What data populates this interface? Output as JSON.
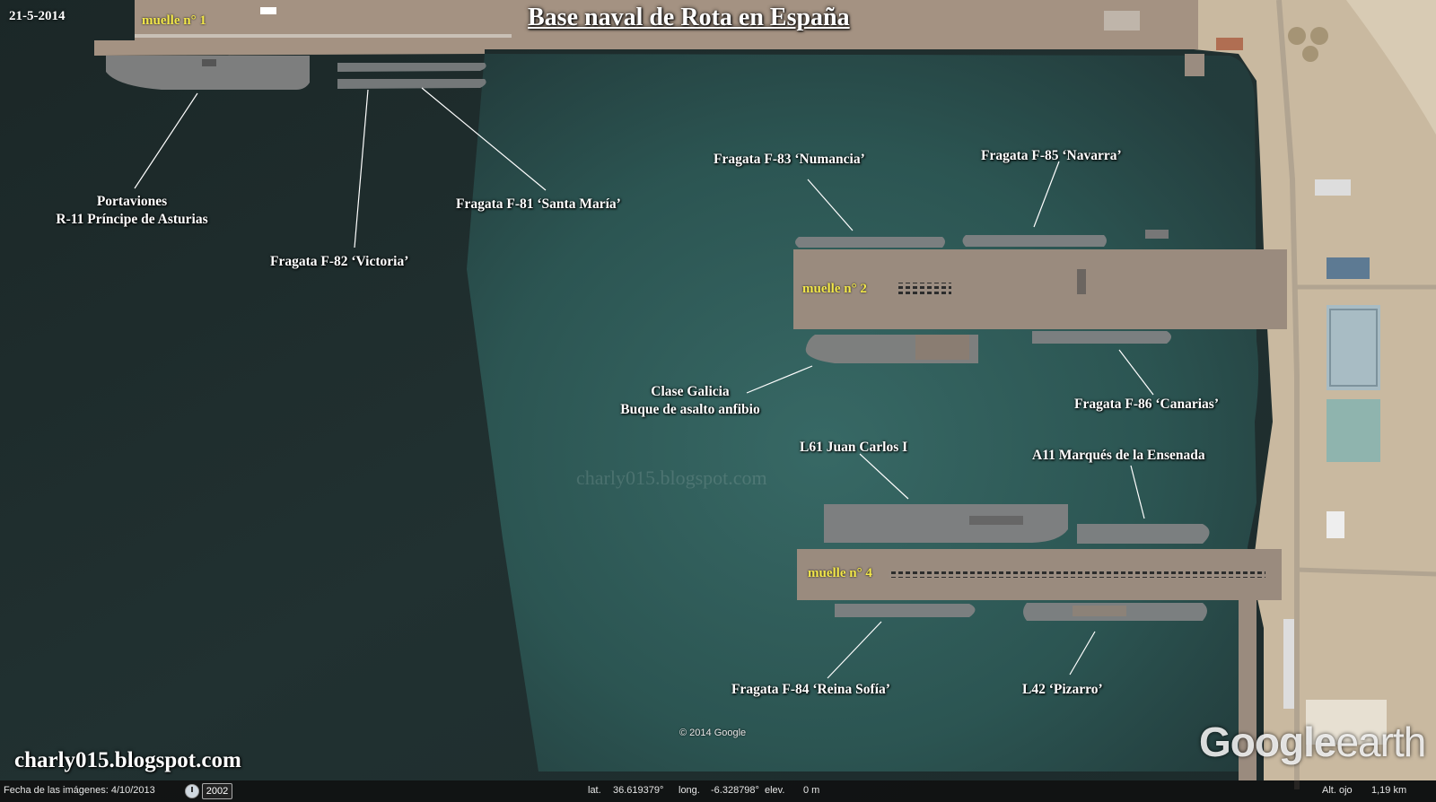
{
  "map": {
    "title": "Base naval de Rota en España",
    "date": "21-5-2014",
    "blog": "charly015.blogspot.com",
    "watermark": "charly015.blogspot.com",
    "copyright": "© 2014 Google",
    "logo": {
      "google": "Google",
      "earth": "earth"
    }
  },
  "piers": {
    "pier1": "muelle n° 1",
    "pier2": "muelle n° 2",
    "pier4": "muelle n° 4"
  },
  "ships": {
    "r11_line1": "Portaviones",
    "r11_line2": "R-11 Príncipe de Asturias",
    "f82": "Fragata F-82  ‘Victoria’",
    "f81": "Fragata F-81 ‘Santa María’",
    "f83": "Fragata F-83 ‘Numancia’",
    "f85": "Fragata F-85 ‘Navarra’",
    "galicia_line1": "Clase Galicia",
    "galicia_line2": "Buque de asalto anfibio",
    "f86": "Fragata F-86 ‘Canarias’",
    "l61": "L61 Juan Carlos I",
    "a11": "A11 Marqués de la Ensenada",
    "f84": "Fragata F-84 ‘Reina Sofía’",
    "l42": "L42 ‘Pizarro’"
  },
  "statusbar": {
    "imagery_date": "Fecha de las imágenes: 4/10/2013",
    "year": "2002",
    "lat_label": "lat.",
    "lat_value": "36.619379°",
    "lon_label": "long.",
    "lon_value": "-6.328798°",
    "elev_label": "elev.",
    "elev_value": "0 m",
    "eye_alt": "Alt. ojo",
    "eye_alt_value": "1,19 km"
  },
  "colors": {
    "water_dark": "#1f2b2c",
    "water_teal": "#2f5f5e",
    "pier": "#9a8c80",
    "land": "#c9b9a0",
    "ship": "#7a7f82",
    "pier_label": "#f3e84a"
  }
}
